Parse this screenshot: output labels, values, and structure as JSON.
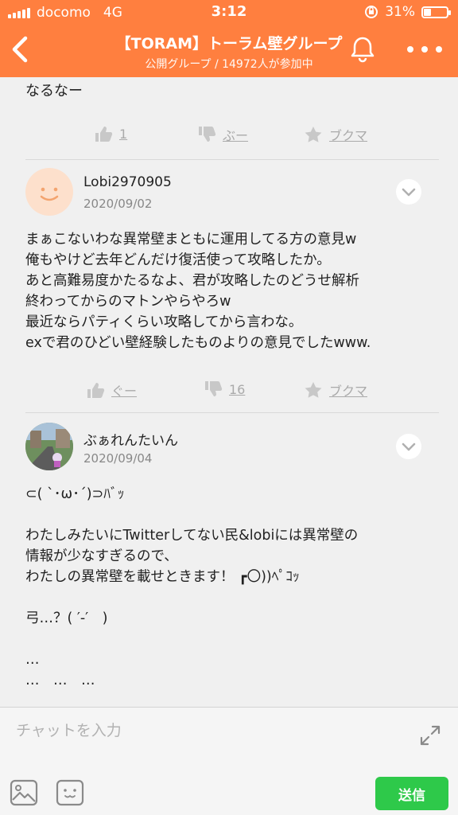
{
  "status_bar": {
    "carrier": "docomo",
    "network": "4G",
    "time": "3:12",
    "battery": "31%",
    "battery_level": 0.31
  },
  "header": {
    "title": "【TORAM】トーラム壁グループ",
    "subtitle": "公開グループ / 14972人が参加中"
  },
  "prev_post": {
    "tail_text": "なるなー",
    "likes": "1",
    "dislikes": "ぶー",
    "bookmark": "ブクマ"
  },
  "posts": [
    {
      "username": "Lobi2970905",
      "date": "2020/09/02",
      "lines": [
        "まぁこないわな異常壁まともに運用してる方の意見w",
        "俺もやけど去年どんだけ復活使って攻略したか。",
        "あと高難易度かたるなよ、君が攻略したのどうせ解析",
        "終わってからのマトンやらやろw",
        "最近ならパティくらい攻略してから言わな。",
        "exで君のひどい壁経験したものよりの意見でしたwww."
      ],
      "likes": "ぐー",
      "dislikes": "16",
      "bookmark": "ブクマ"
    },
    {
      "username": "ぶぁれんたいん",
      "date": "2020/09/04",
      "lines": [
        "⊂( ˋ･ω･ˊ)⊃ﾊﾞｯ",
        "",
        "わたしみたいにTwitterしてない民&lobiには異常壁の",
        "情報が少なすぎるので、",
        "わたしの異常壁を載せときます！ ┏〇))ﾍﾟｺｯ",
        "",
        "弓…？( ′-′　)",
        "",
        "…",
        "…　…　…"
      ]
    }
  ],
  "input": {
    "placeholder": "チャットを入力",
    "send_label": "送信"
  },
  "colors": {
    "header_bg": "#ff7f3f",
    "send_button": "#2ec94a"
  }
}
